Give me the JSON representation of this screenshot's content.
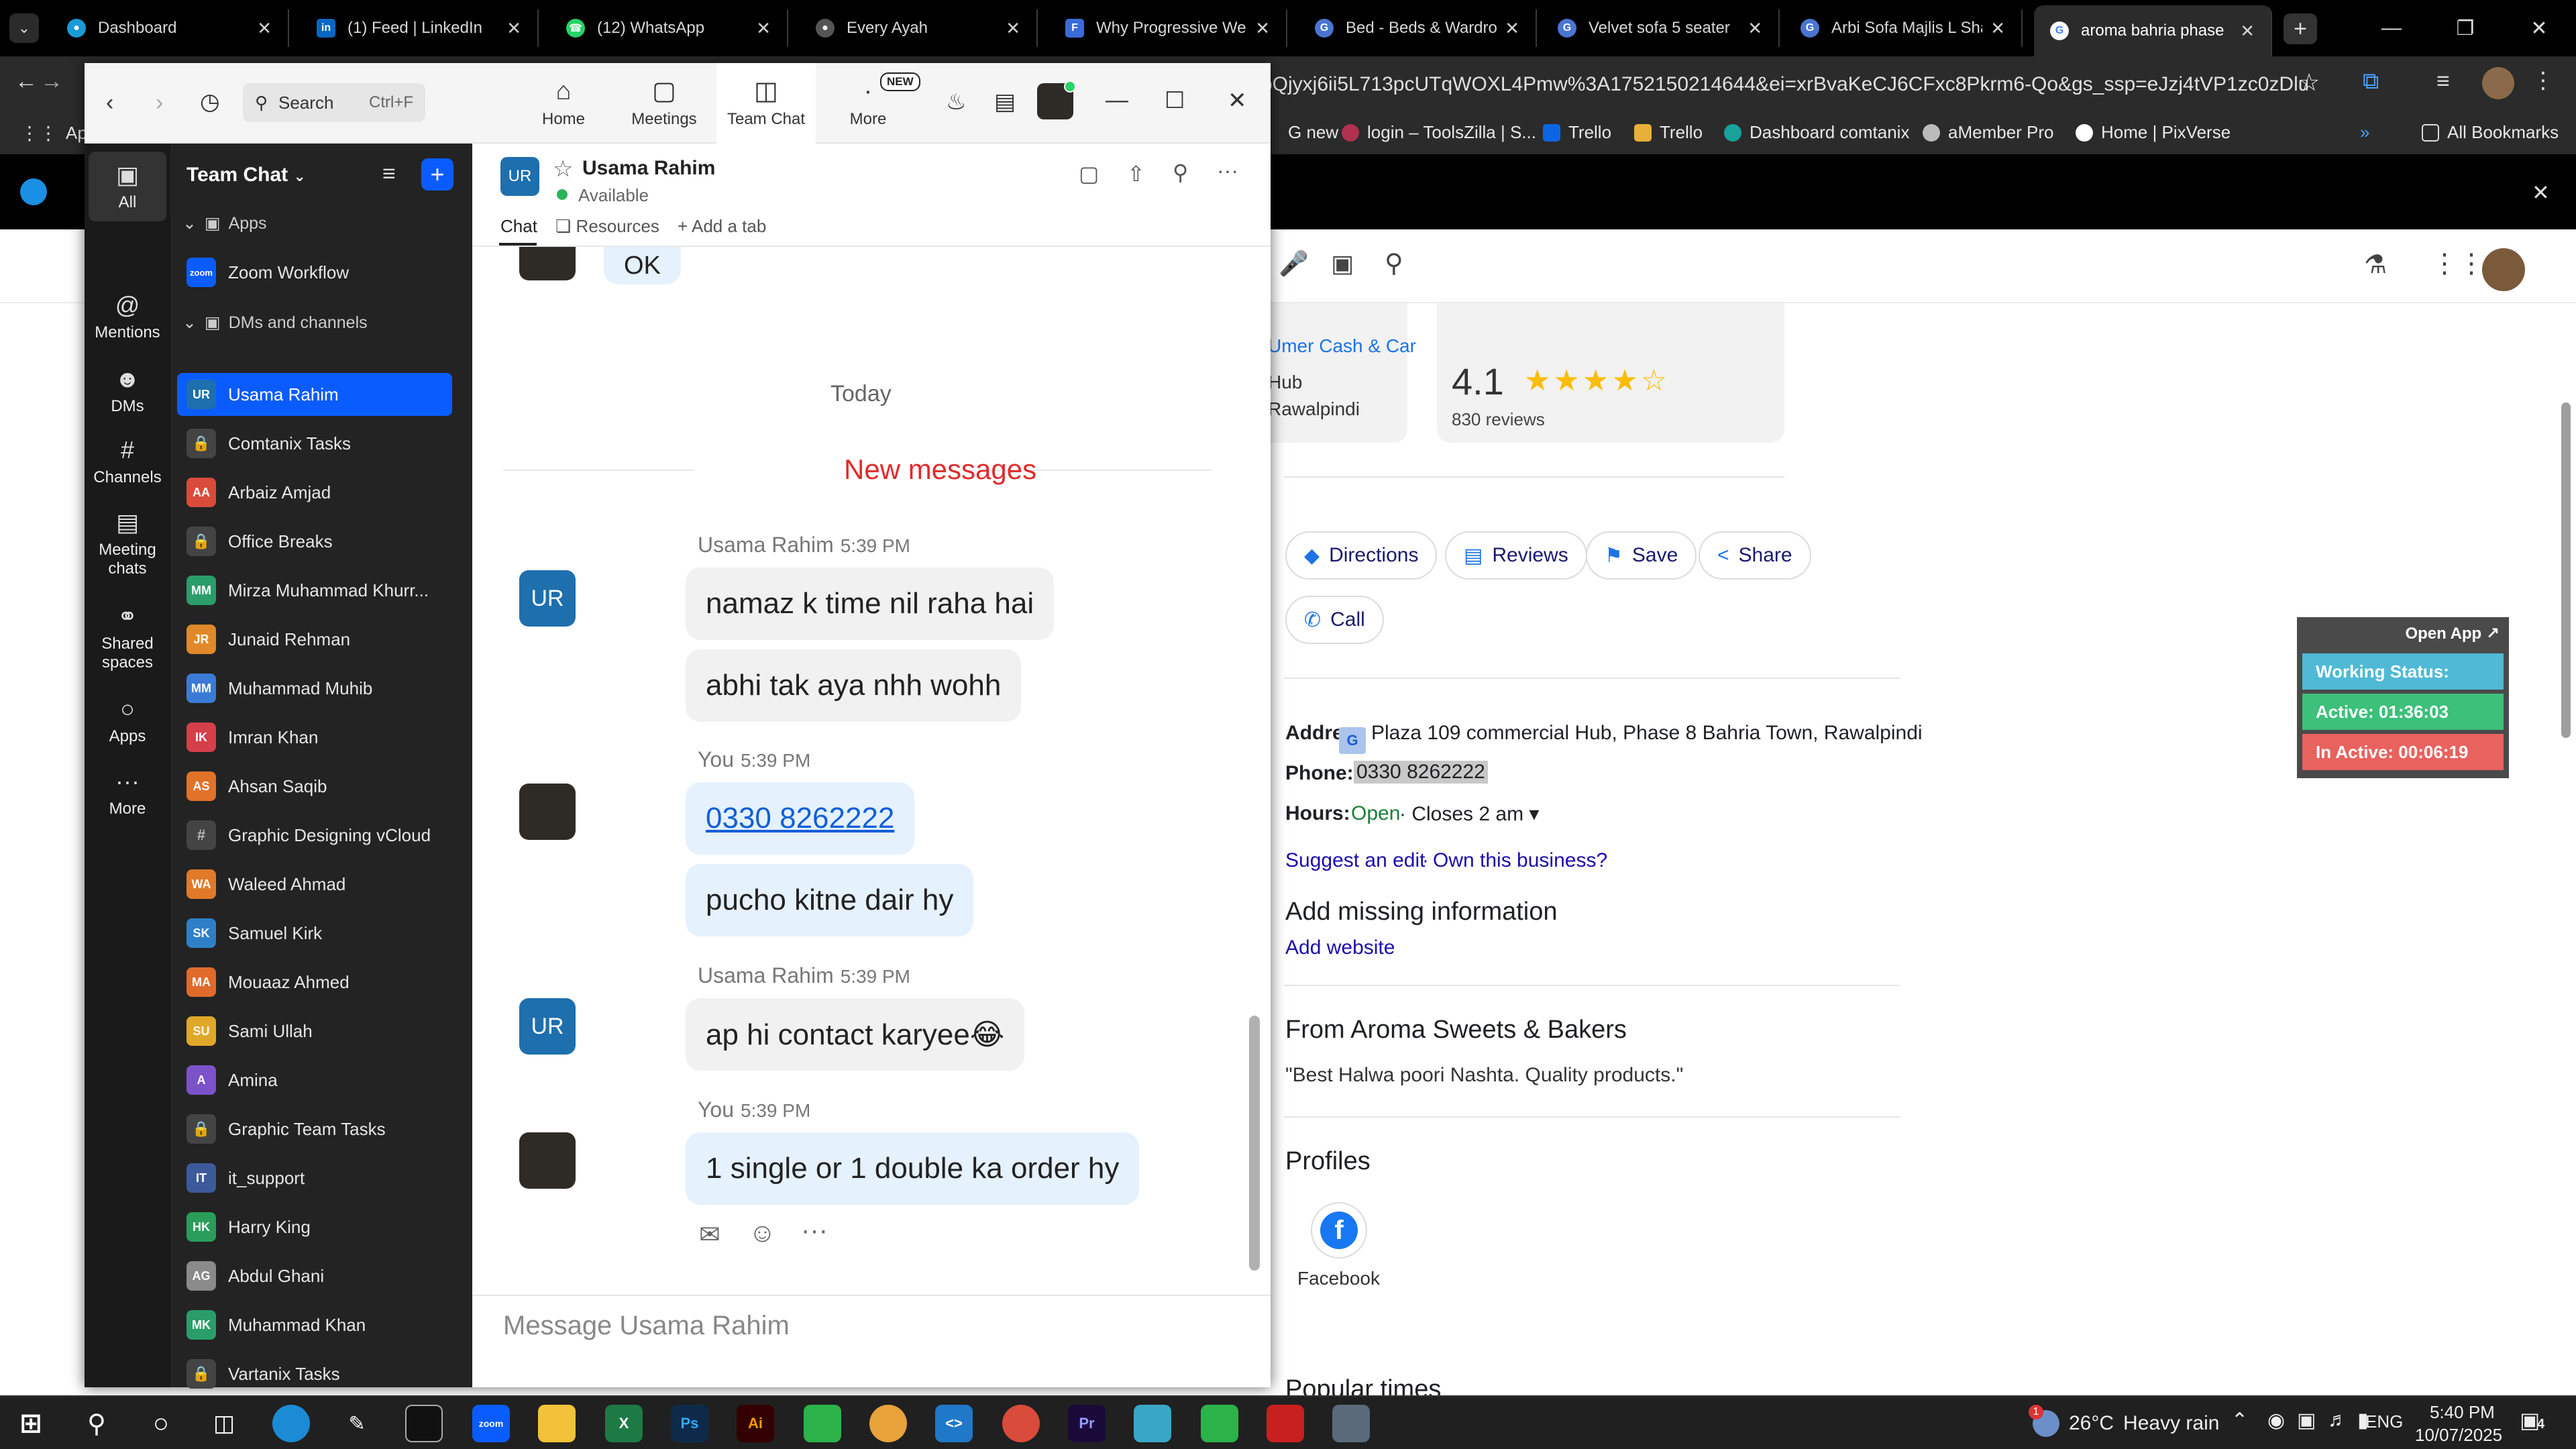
{
  "browser": {
    "tabs": [
      {
        "title": "Dashboard",
        "color": "#1a9bd7"
      },
      {
        "title": "(1) Feed | LinkedIn",
        "color": "#0a66c2"
      },
      {
        "title": "(12) WhatsApp",
        "color": "#25d366"
      },
      {
        "title": "Every Ayah",
        "color": "#666666"
      },
      {
        "title": "Why Progressive Web",
        "color": "#3b6bd6"
      },
      {
        "title": "Bed - Beds & Wardro",
        "color": "#4a76d1"
      },
      {
        "title": "Velvet sofa 5 seater",
        "color": "#4a76d1"
      },
      {
        "title": "Arbi Sofa Majlis L Sha",
        "color": "#4a76d1"
      },
      {
        "title": "aroma bahria phase",
        "color": "#ea4335"
      }
    ],
    "url": "oQjyxj6ii5L713pcUTqWOXL4Pmw%3A1752150214644&ei=xrBvaKeCJ6CFxc8Pkrm6-Qo&gs_ssp=eJzj4tVP1zc0zDluM81KK...",
    "bookmarks": [
      "App",
      "G new",
      "login – ToolsZilla | S...",
      "Trello",
      "Trello",
      "Dashboard comtanix",
      "aMember Pro",
      "Home | PixVerse",
      "All Bookmarks"
    ]
  },
  "google": {
    "map_labels": [
      "Umer Cash & Car",
      "Hub",
      "Rawalpindi"
    ],
    "rating": "4.1",
    "stars": "★★★★☆",
    "reviews": "830 reviews",
    "actions": [
      "Directions",
      "Reviews",
      "Save",
      "Share",
      "Call"
    ],
    "address_label": "Addre",
    "address": "Plaza 109 commercial Hub, Phase 8 Bahria Town, Rawalpindi",
    "phone_label": "Phone:",
    "phone": "0330 8262222",
    "hours_label": "Hours:",
    "hours_open": "Open",
    "hours_close": "· Closes 2 am ▾",
    "suggest": "Suggest an edit",
    "sep": "·",
    "own": "Own this business?",
    "missing_title": "Add missing information",
    "add_website": "Add website",
    "from_title": "From Aroma Sweets & Bakers",
    "quote": "\"Best Halwa poori Nashta. Quality products.\"",
    "profiles_title": "Profiles",
    "facebook": "Facebook",
    "popular": "Popular times"
  },
  "activity": {
    "open_app": "Open App ↗",
    "working": "Working Status: Active",
    "active": "Active: 01:36:03",
    "inactive": "In Active: 00:06:19"
  },
  "zoom": {
    "search": "Search",
    "search_kbd": "Ctrl+F",
    "nav": [
      "Home",
      "Meetings",
      "Team Chat",
      "More"
    ],
    "new_badge": "NEW",
    "rail": [
      "All",
      "Mentions",
      "DMs",
      "Channels",
      "Meeting chats",
      "Shared spaces",
      "Apps",
      "More"
    ],
    "sidebar_title": "Team Chat",
    "apps_section": "Apps",
    "app_item": "Zoom Workflow",
    "dm_section": "DMs and channels",
    "channels": [
      {
        "name": "Usama Rahim",
        "init": "UR",
        "color": "#1e6fae",
        "lock": false
      },
      {
        "name": "Comtanix Tasks",
        "init": "",
        "color": "#444444",
        "lock": true
      },
      {
        "name": "Arbaiz Amjad",
        "init": "AA",
        "color": "#d94b3a",
        "lock": false
      },
      {
        "name": "Office Breaks",
        "init": "",
        "color": "#444444",
        "lock": true
      },
      {
        "name": "Mirza Muhammad Khurr...",
        "init": "MM",
        "color": "#2a9d6a",
        "lock": false
      },
      {
        "name": "Junaid Rehman",
        "init": "JR",
        "color": "#e0892a",
        "lock": false
      },
      {
        "name": "Muhammad Muhib",
        "init": "MM",
        "color": "#3a7bd5",
        "lock": false
      },
      {
        "name": "Imran Khan",
        "init": "IK",
        "color": "#d43f4a",
        "lock": false
      },
      {
        "name": "Ahsan Saqib",
        "init": "AS",
        "color": "#e0722a",
        "lock": false
      },
      {
        "name": "Graphic Designing vCloud",
        "init": "#",
        "color": "#444444",
        "lock": true
      },
      {
        "name": "Waleed Ahmad",
        "init": "WA",
        "color": "#e07a2a",
        "lock": false
      },
      {
        "name": "Samuel Kirk",
        "init": "SK",
        "color": "#2f7fc7",
        "lock": false
      },
      {
        "name": "Mouaaz Ahmed",
        "init": "MA",
        "color": "#e06a2a",
        "lock": false
      },
      {
        "name": "Sami Ullah",
        "init": "SU",
        "color": "#e0a82a",
        "lock": false
      },
      {
        "name": "Amina",
        "init": "A",
        "color": "#7b52c9",
        "lock": false
      },
      {
        "name": "Graphic Team Tasks",
        "init": "",
        "color": "#444444",
        "lock": true
      },
      {
        "name": "it_support",
        "init": "IT",
        "color": "#3c5a9a",
        "lock": false
      },
      {
        "name": "Harry King",
        "init": "HK",
        "color": "#2a9d5a",
        "lock": false
      },
      {
        "name": "Abdul Ghani",
        "init": "AG",
        "color": "#8a8a8a",
        "lock": false
      },
      {
        "name": "Muhammad Khan",
        "init": "MK",
        "color": "#2a9d6a",
        "lock": false
      },
      {
        "name": "Vartanix Tasks",
        "init": "",
        "color": "#444444",
        "lock": true
      }
    ],
    "chat": {
      "contact": "Usama Rahim",
      "status": "Available",
      "contact_init": "UR",
      "tabs": [
        "Chat",
        "Resources",
        "+ Add a tab"
      ],
      "prev_message": "OK",
      "today": "Today",
      "new_messages": "New messages",
      "messages": [
        {
          "sender": "Usama Rahim",
          "time": "5:39 PM",
          "lines": [
            "namaz k time nil raha hai",
            "abhi tak aya nhh wohh"
          ],
          "mine": false
        },
        {
          "sender": "You",
          "time": "5:39 PM",
          "lines": [
            "0330 8262222",
            "pucho kitne dair hy"
          ],
          "mine": true
        },
        {
          "sender": "Usama Rahim",
          "time": "5:39 PM",
          "lines": [
            "ap hi contact karyee😂"
          ],
          "mine": false
        },
        {
          "sender": "You",
          "time": "5:39 PM",
          "lines": [
            "1 single or 1 double ka order hy"
          ],
          "mine": true
        }
      ],
      "compose_placeholder": "Message Usama Rahim"
    }
  },
  "taskbar": {
    "weather_temp": "26°C",
    "weather_desc": "Heavy rain",
    "lang": "ENG",
    "time": "5:40 PM",
    "date": "10/07/2025",
    "notif": "4",
    "weather_badge": "1"
  }
}
